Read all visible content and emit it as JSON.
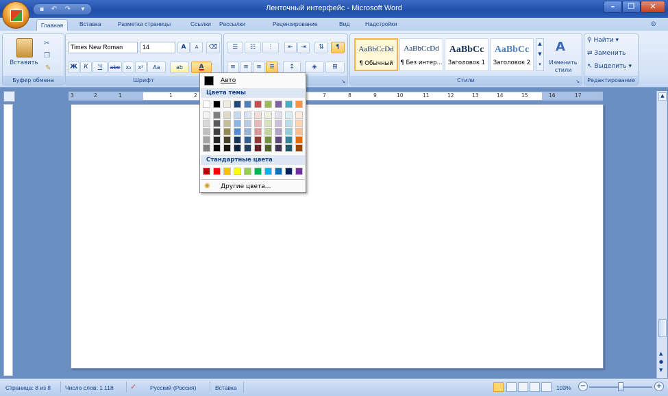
{
  "window": {
    "title": "Ленточный интерфейс - Microsoft Word",
    "qat": [
      "save-icon",
      "undo-icon",
      "redo-icon",
      "customize-icon"
    ],
    "controls": [
      "minimize",
      "maximize",
      "close"
    ]
  },
  "tabs": [
    "Главная",
    "Вставка",
    "Разметка страницы",
    "Ссылки",
    "Рассылки",
    "Рецензирование",
    "Вид",
    "Надстройки"
  ],
  "ribbon": {
    "clipboard": {
      "paste_label": "Вставить",
      "group_label": "Буфер обмена"
    },
    "font": {
      "font_name": "Times New Roman",
      "font_size": "14",
      "grow": "A",
      "shrink": "A",
      "bold": "Ж",
      "italic": "К",
      "underline": "Ч",
      "strike": "abe",
      "subscript": "x₂",
      "superscript": "x²",
      "case": "Aa",
      "font_color_glyph": "A",
      "highlight_glyph": "ab",
      "group_label": "Шрифт"
    },
    "paragraph": {
      "group_label": "Абзац"
    },
    "styles": {
      "items": [
        {
          "sample": "AaBbCcDd",
          "name": "¶ Обычный"
        },
        {
          "sample": "AaBbCcDd",
          "name": "¶ Без интер..."
        },
        {
          "sample": "AaBbCc",
          "name": "Заголовок 1"
        },
        {
          "sample": "AaBbCc",
          "name": "Заголовок 2"
        }
      ],
      "change_styles": "Изменить стили",
      "group_label": "Стили"
    },
    "editing": {
      "find": "Найти",
      "replace": "Заменить",
      "select": "Выделить",
      "group_label": "Редактирование"
    }
  },
  "ruler": {
    "ticks": [
      "3",
      "2",
      "1",
      "1",
      "2",
      "7",
      "8",
      "9",
      "10",
      "11",
      "12",
      "13",
      "14",
      "15",
      "16",
      "17"
    ]
  },
  "color_picker": {
    "auto_label": "Авто",
    "theme_header": "Цвета темы",
    "standard_header": "Стандартные цвета",
    "more_colors": "Другие цвета...",
    "theme_top": [
      "#ffffff",
      "#000000",
      "#eeece1",
      "#1f497d",
      "#4f81bd",
      "#c0504d",
      "#9bbb59",
      "#8064a2",
      "#4bacc6",
      "#f79646"
    ],
    "theme_shades": [
      [
        "#f2f2f2",
        "#7f7f7f",
        "#ddd9c3",
        "#c6d9f0",
        "#dbe5f1",
        "#f2dcdb",
        "#ebf1dd",
        "#e5e0ec",
        "#dbeef3",
        "#fdeada"
      ],
      [
        "#d8d8d8",
        "#595959",
        "#c4bd97",
        "#8db3e2",
        "#b8cce4",
        "#e5b9b7",
        "#d7e3bc",
        "#ccc1d9",
        "#b7dde8",
        "#fbd5b5"
      ],
      [
        "#bfbfbf",
        "#3f3f3f",
        "#938953",
        "#548dd4",
        "#95b3d7",
        "#d99694",
        "#c3d69b",
        "#b2a2c7",
        "#92cddc",
        "#fac08f"
      ],
      [
        "#a5a5a5",
        "#262626",
        "#494429",
        "#17365d",
        "#366092",
        "#953734",
        "#76923c",
        "#5f497a",
        "#31859b",
        "#e36c09"
      ],
      [
        "#7f7f7f",
        "#0c0c0c",
        "#1d1b10",
        "#0f243e",
        "#244061",
        "#632423",
        "#4f6128",
        "#3f3151",
        "#205867",
        "#974806"
      ]
    ],
    "standard": [
      "#c00000",
      "#ff0000",
      "#ffc000",
      "#ffff00",
      "#92d050",
      "#00b050",
      "#00b0f0",
      "#0070c0",
      "#002060",
      "#7030a0"
    ]
  },
  "status": {
    "page": "Страница: 8 из 8",
    "words": "Число слов: 1 118",
    "language": "Русский (Россия)",
    "mode": "Вставка",
    "zoom": "103%"
  }
}
